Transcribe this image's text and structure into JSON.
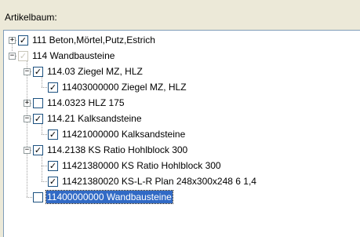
{
  "panel": {
    "title": "Artikelbaum:"
  },
  "tree": {
    "nodes": [
      {
        "label": "111 Beton,Mörtel,Putz,Estrich",
        "checked": true,
        "expander": "+",
        "level": 0
      },
      {
        "label": "114 Wandbausteine",
        "checked": true,
        "disabled": true,
        "expander": "−",
        "level": 0
      },
      {
        "label": "114.03 Ziegel MZ, HLZ",
        "checked": true,
        "expander": "−",
        "level": 1
      },
      {
        "label": "11403000000 Ziegel MZ, HLZ",
        "checked": true,
        "expander": "",
        "level": 2
      },
      {
        "label": "114.0323 HLZ 175",
        "checked": false,
        "expander": "+",
        "level": 1
      },
      {
        "label": "114.21 Kalksandsteine",
        "checked": true,
        "expander": "−",
        "level": 1
      },
      {
        "label": "11421000000 Kalksandsteine",
        "checked": true,
        "expander": "",
        "level": 2
      },
      {
        "label": "114.2138 KS Ratio Hohlblock 300",
        "checked": true,
        "expander": "−",
        "level": 1
      },
      {
        "label": "11421380000 KS Ratio Hohlblock 300",
        "checked": true,
        "expander": "",
        "level": 2
      },
      {
        "label": "11421380020 KS-L-R Plan 248x300x248   6  1,4",
        "checked": true,
        "expander": "",
        "level": 2
      },
      {
        "label": "11400000000 Wandbausteine",
        "checked": false,
        "expander": "",
        "level": 1,
        "selected": true
      }
    ]
  }
}
